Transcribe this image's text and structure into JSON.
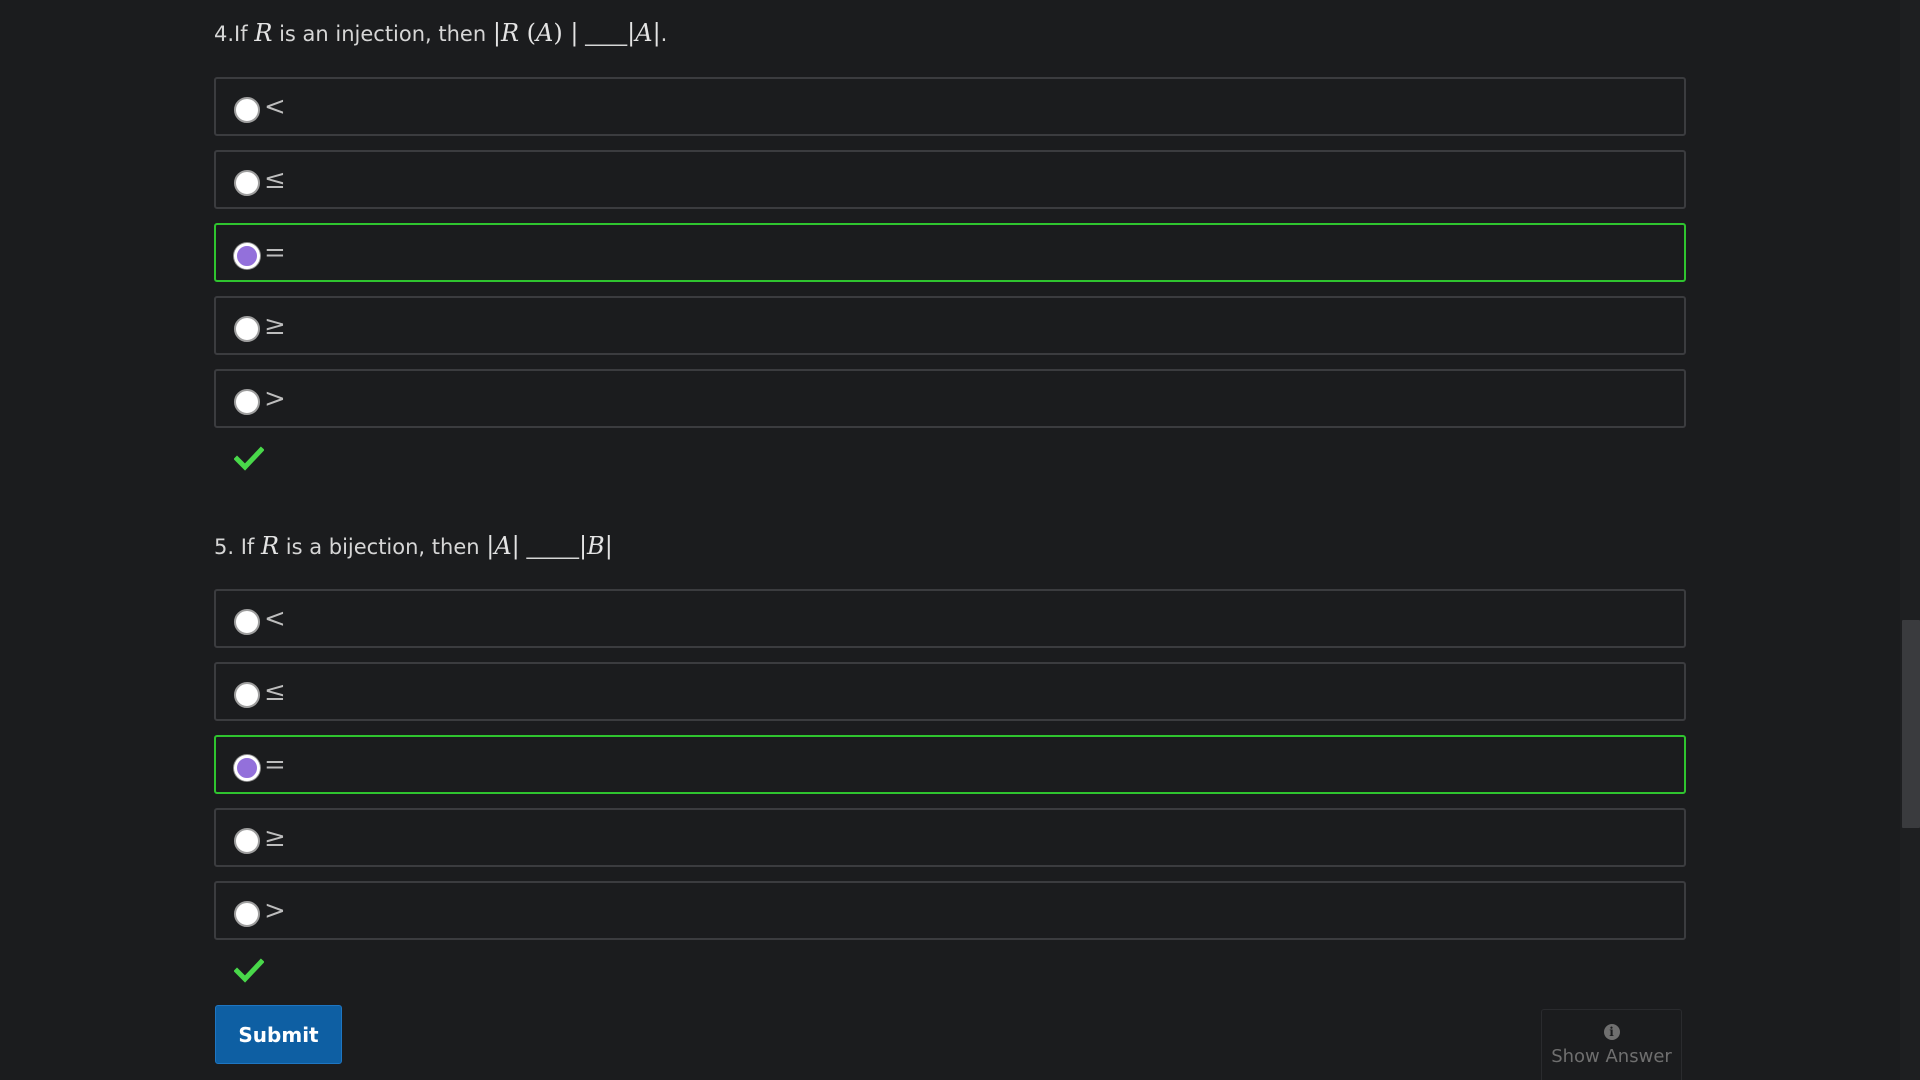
{
  "questions": [
    {
      "prefix": "4.If ",
      "var_r": "R",
      "mid": " is an injection, then ",
      "math_a": "|",
      "math_b": "R",
      "math_c": " (",
      "math_d": "A",
      "math_e": ") |",
      "blank": " ____",
      "math_f": "|",
      "math_g": "A",
      "math_h": "|",
      "suffix": ".",
      "options": [
        {
          "label": "<",
          "checked": false,
          "correct": false
        },
        {
          "label": "≤",
          "checked": false,
          "correct": false
        },
        {
          "label": "=",
          "checked": true,
          "correct": true
        },
        {
          "label": "≥",
          "checked": false,
          "correct": false
        },
        {
          "label": ">",
          "checked": false,
          "correct": false
        }
      ],
      "status_icon": "check-icon"
    },
    {
      "prefix": "5. If ",
      "var_r": "R",
      "mid": " is a bijection, then ",
      "math_a": "|",
      "math_b": "A",
      "math_c": "|",
      "blank": " _____",
      "math_f": "|",
      "math_g": "B",
      "math_h": "|",
      "options": [
        {
          "label": "<",
          "checked": false,
          "correct": false
        },
        {
          "label": "≤",
          "checked": false,
          "correct": false
        },
        {
          "label": "=",
          "checked": true,
          "correct": true
        },
        {
          "label": "≥",
          "checked": false,
          "correct": false
        },
        {
          "label": ">",
          "checked": false,
          "correct": false
        }
      ],
      "status_icon": "check-icon"
    }
  ],
  "submit_label": "Submit",
  "show_answer": {
    "label": "Show Answer",
    "icon": "info-icon",
    "glyph": "i"
  },
  "colors": {
    "background": "#1b1c1e",
    "correct_border": "#2fc42f",
    "checkmark": "#49d84a",
    "selected_radio": "#9370db",
    "submit_bg": "#0e5fa3"
  }
}
